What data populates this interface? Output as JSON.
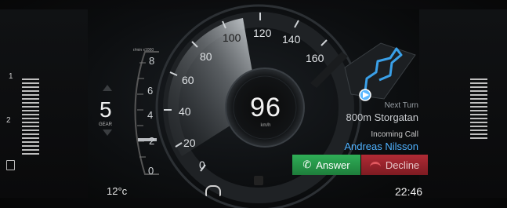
{
  "gear": {
    "value": "5",
    "label": "GEAR"
  },
  "rpm": {
    "unit": "r/min x1000",
    "ticks": [
      "8",
      "6",
      "4",
      "2",
      "0"
    ]
  },
  "speedometer": {
    "value": "96",
    "unit": "km/h",
    "ticks": [
      "0",
      "20",
      "40",
      "60",
      "80",
      "100",
      "120",
      "140",
      "160"
    ],
    "max": 160,
    "current": 96
  },
  "navigation": {
    "next_turn_label": "Next Turn",
    "next_turn_distance": "800m Storgatan"
  },
  "call": {
    "label": "Incoming Call",
    "caller": "Andreas Nilsson",
    "answer_label": "Answer",
    "decline_label": "Decline"
  },
  "status": {
    "temperature": "12°c",
    "time": "22:46"
  },
  "left_gauge": {
    "marks": [
      "1",
      "2"
    ]
  },
  "colors": {
    "answer": "#28a04c",
    "decline": "#a0232d",
    "caller": "#4fb2ff",
    "route": "#3aa0e8"
  },
  "icons": [
    "phone-answer-icon",
    "phone-decline-icon",
    "speed-limiter-icon",
    "fuel-icon",
    "nav-arrow-icon"
  ]
}
